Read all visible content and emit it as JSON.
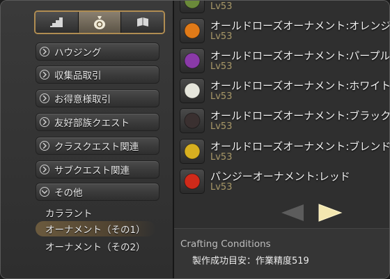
{
  "tabs": [
    {
      "icon": "stairs-icon",
      "active": false
    },
    {
      "icon": "money-bag-icon",
      "active": true
    },
    {
      "icon": "book-icon",
      "active": false
    }
  ],
  "categories": [
    {
      "label": "ハウジング",
      "expanded": false
    },
    {
      "label": "収集品取引",
      "expanded": false
    },
    {
      "label": "お得意様取引",
      "expanded": false
    },
    {
      "label": "友好部族クエスト",
      "expanded": false
    },
    {
      "label": "クラスクエスト関連",
      "expanded": false
    },
    {
      "label": "サブクエスト関連",
      "expanded": false
    },
    {
      "label": "その他",
      "expanded": true
    }
  ],
  "subcategories": [
    {
      "label": "カララント",
      "selected": false
    },
    {
      "label": "オーナメント（その1）",
      "selected": true
    },
    {
      "label": "オーナメント（その2）",
      "selected": false
    }
  ],
  "items": [
    {
      "name": "",
      "level": "Lv53",
      "color": "#6b8a3a"
    },
    {
      "name": "オールドローズオーナメント:オレンジ",
      "level": "Lv53",
      "color": "#e07a18"
    },
    {
      "name": "オールドローズオーナメント:パープル",
      "level": "Lv53",
      "color": "#8a3aa8"
    },
    {
      "name": "オールドローズオーナメント:ホワイト",
      "level": "Lv53",
      "color": "#e6e6dc"
    },
    {
      "name": "オールドローズオーナメント:ブラック",
      "level": "Lv53",
      "color": "#3a3030"
    },
    {
      "name": "オールドローズオーナメント:ブレンド",
      "level": "Lv53",
      "color": "#d8b020"
    },
    {
      "name": "パンジーオーナメント:レッド",
      "level": "Lv53",
      "color": "#d02a1a"
    }
  ],
  "conditions": {
    "heading": "Crafting Conditions",
    "value": "製作成功目安：作業精度519"
  }
}
